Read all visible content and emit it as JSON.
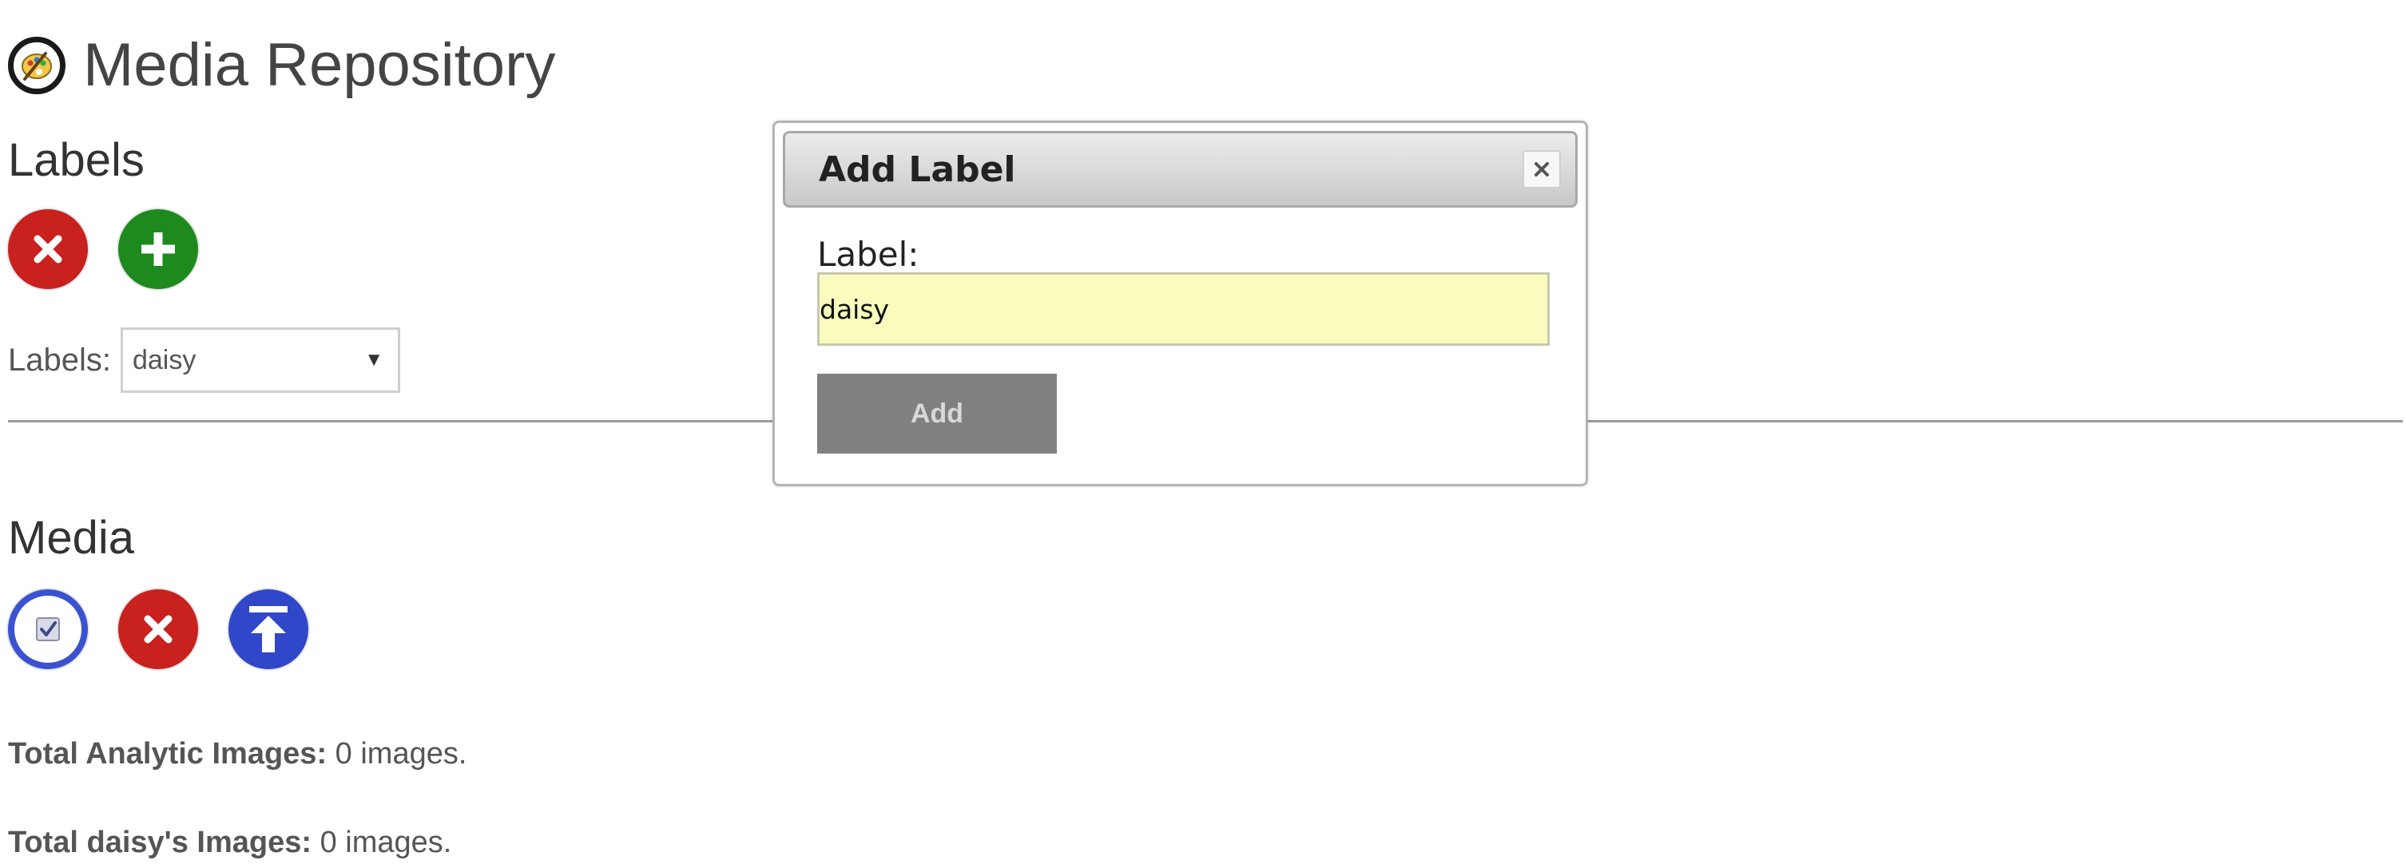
{
  "app": {
    "title": "Media Repository",
    "logo_icon": "palette-logo-icon"
  },
  "labels_section": {
    "heading": "Labels",
    "actions": [
      {
        "name": "delete-label",
        "icon": "x-icon",
        "color": "#c9211e"
      },
      {
        "name": "add-label",
        "icon": "plus-icon",
        "color": "#1e8a1e"
      }
    ],
    "select_caption": "Labels:",
    "select_value": "daisy"
  },
  "media_section": {
    "heading": "Media",
    "actions": [
      {
        "name": "select-all-media",
        "icon": "checkbox-icon",
        "color": "#3a52d0"
      },
      {
        "name": "delete-media",
        "icon": "x-icon",
        "color": "#c9211e"
      },
      {
        "name": "upload-media",
        "icon": "upload-arrow-icon",
        "color": "#2f47c8"
      }
    ]
  },
  "stats": {
    "analytic_label": "Total Analytic Images:",
    "analytic_value": "0 images.",
    "daisy_label": "Total daisy's Images:",
    "daisy_value": "0 images."
  },
  "dialog": {
    "title": "Add Label",
    "field_caption": "Label:",
    "field_value": "daisy",
    "submit_label": "Add",
    "close_icon": "close-icon"
  }
}
